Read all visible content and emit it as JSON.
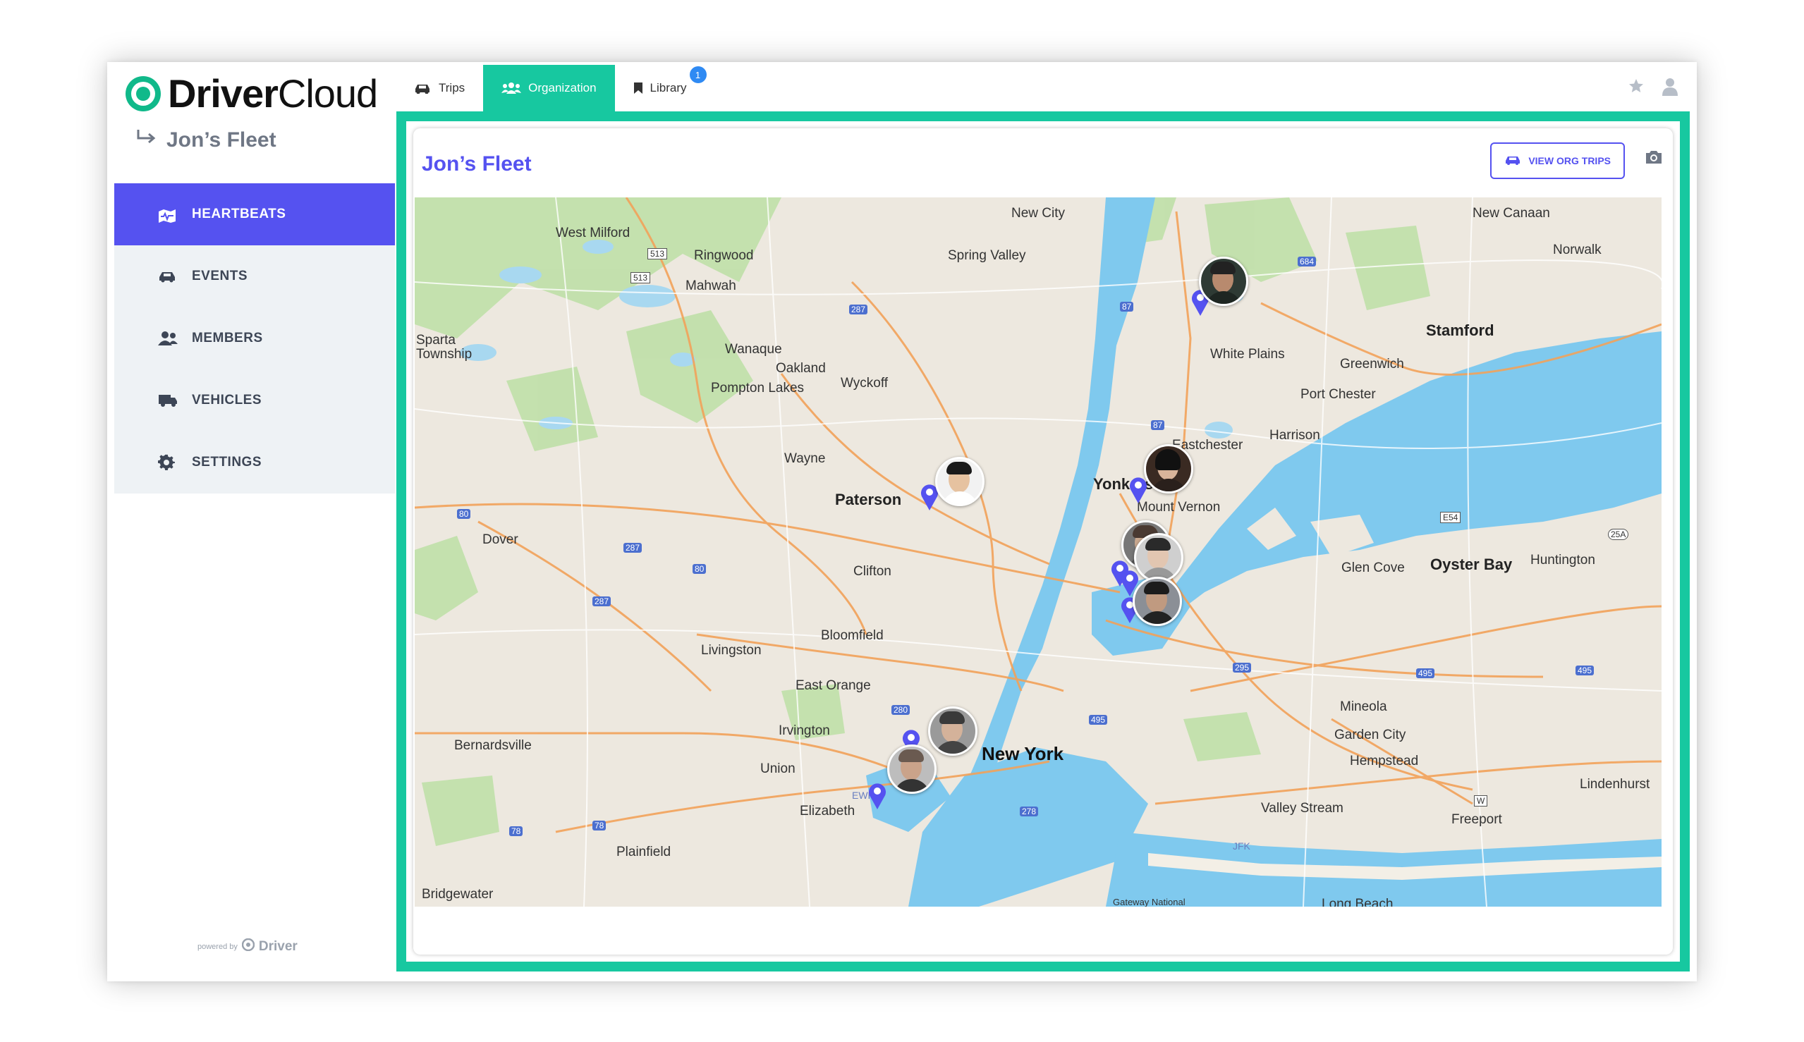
{
  "app": {
    "brand_bold": "Driver",
    "brand_light": "Cloud",
    "accent": "#17c8a0",
    "primary": "#5552f0"
  },
  "tabs": [
    {
      "label": "Trips",
      "icon": "car-icon"
    },
    {
      "label": "Organization",
      "icon": "group-icon",
      "active": true
    },
    {
      "label": "Library",
      "icon": "bookmark-icon",
      "badge": "1"
    }
  ],
  "header_icons": [
    "star-icon",
    "user-icon"
  ],
  "sidebar": {
    "breadcrumb": "Jon’s Fleet",
    "items": [
      {
        "label": "HEARTBEATS",
        "icon": "map-pulse-icon",
        "active": true
      },
      {
        "label": "EVENTS",
        "icon": "car-alert-icon"
      },
      {
        "label": "MEMBERS",
        "icon": "members-icon"
      },
      {
        "label": "VEHICLES",
        "icon": "truck-icon"
      },
      {
        "label": "SETTINGS",
        "icon": "gear-icon"
      }
    ],
    "powered_by": "powered by",
    "powered_brand": "Driver"
  },
  "main": {
    "title": "Jon’s Fleet",
    "view_org_trips": "VIEW ORG TRIPS",
    "camera_icon": "camera-icon"
  },
  "map": {
    "labels": [
      "West Milford",
      "Ringwood",
      "Mahwah",
      "New City",
      "Spring Valley",
      "New Canaan",
      "Norwalk",
      "Sparta Township",
      "Wanaque",
      "Oakland",
      "Pompton Lakes",
      "Wyckoff",
      "White Plains",
      "Stamford",
      "Greenwich",
      "Port Chester",
      "Eastchester",
      "Harrison",
      "Wayne",
      "Paterson",
      "Yonkers",
      "Mount Vernon",
      "Dover",
      "Clifton",
      "Glen Cove",
      "Oyster Bay",
      "Huntington",
      "Bloomfield",
      "Livingston",
      "East Orange",
      "Irvington",
      "New York",
      "Mineola",
      "Garden City",
      "Hempstead",
      "Bernardsville",
      "Union",
      "Elizabeth",
      "Lindenhurst",
      "Valley Stream",
      "Freeport",
      "Plainfield",
      "Bridgewater",
      "Long Beach",
      "Gateway National",
      "JFK",
      "EWR"
    ],
    "shields": [
      "513",
      "513",
      "287",
      "87",
      "684",
      "80",
      "287",
      "80",
      "287",
      "87",
      "E54",
      "25A",
      "280",
      "495",
      "295",
      "495",
      "495",
      "78",
      "78",
      "278",
      "W"
    ]
  }
}
